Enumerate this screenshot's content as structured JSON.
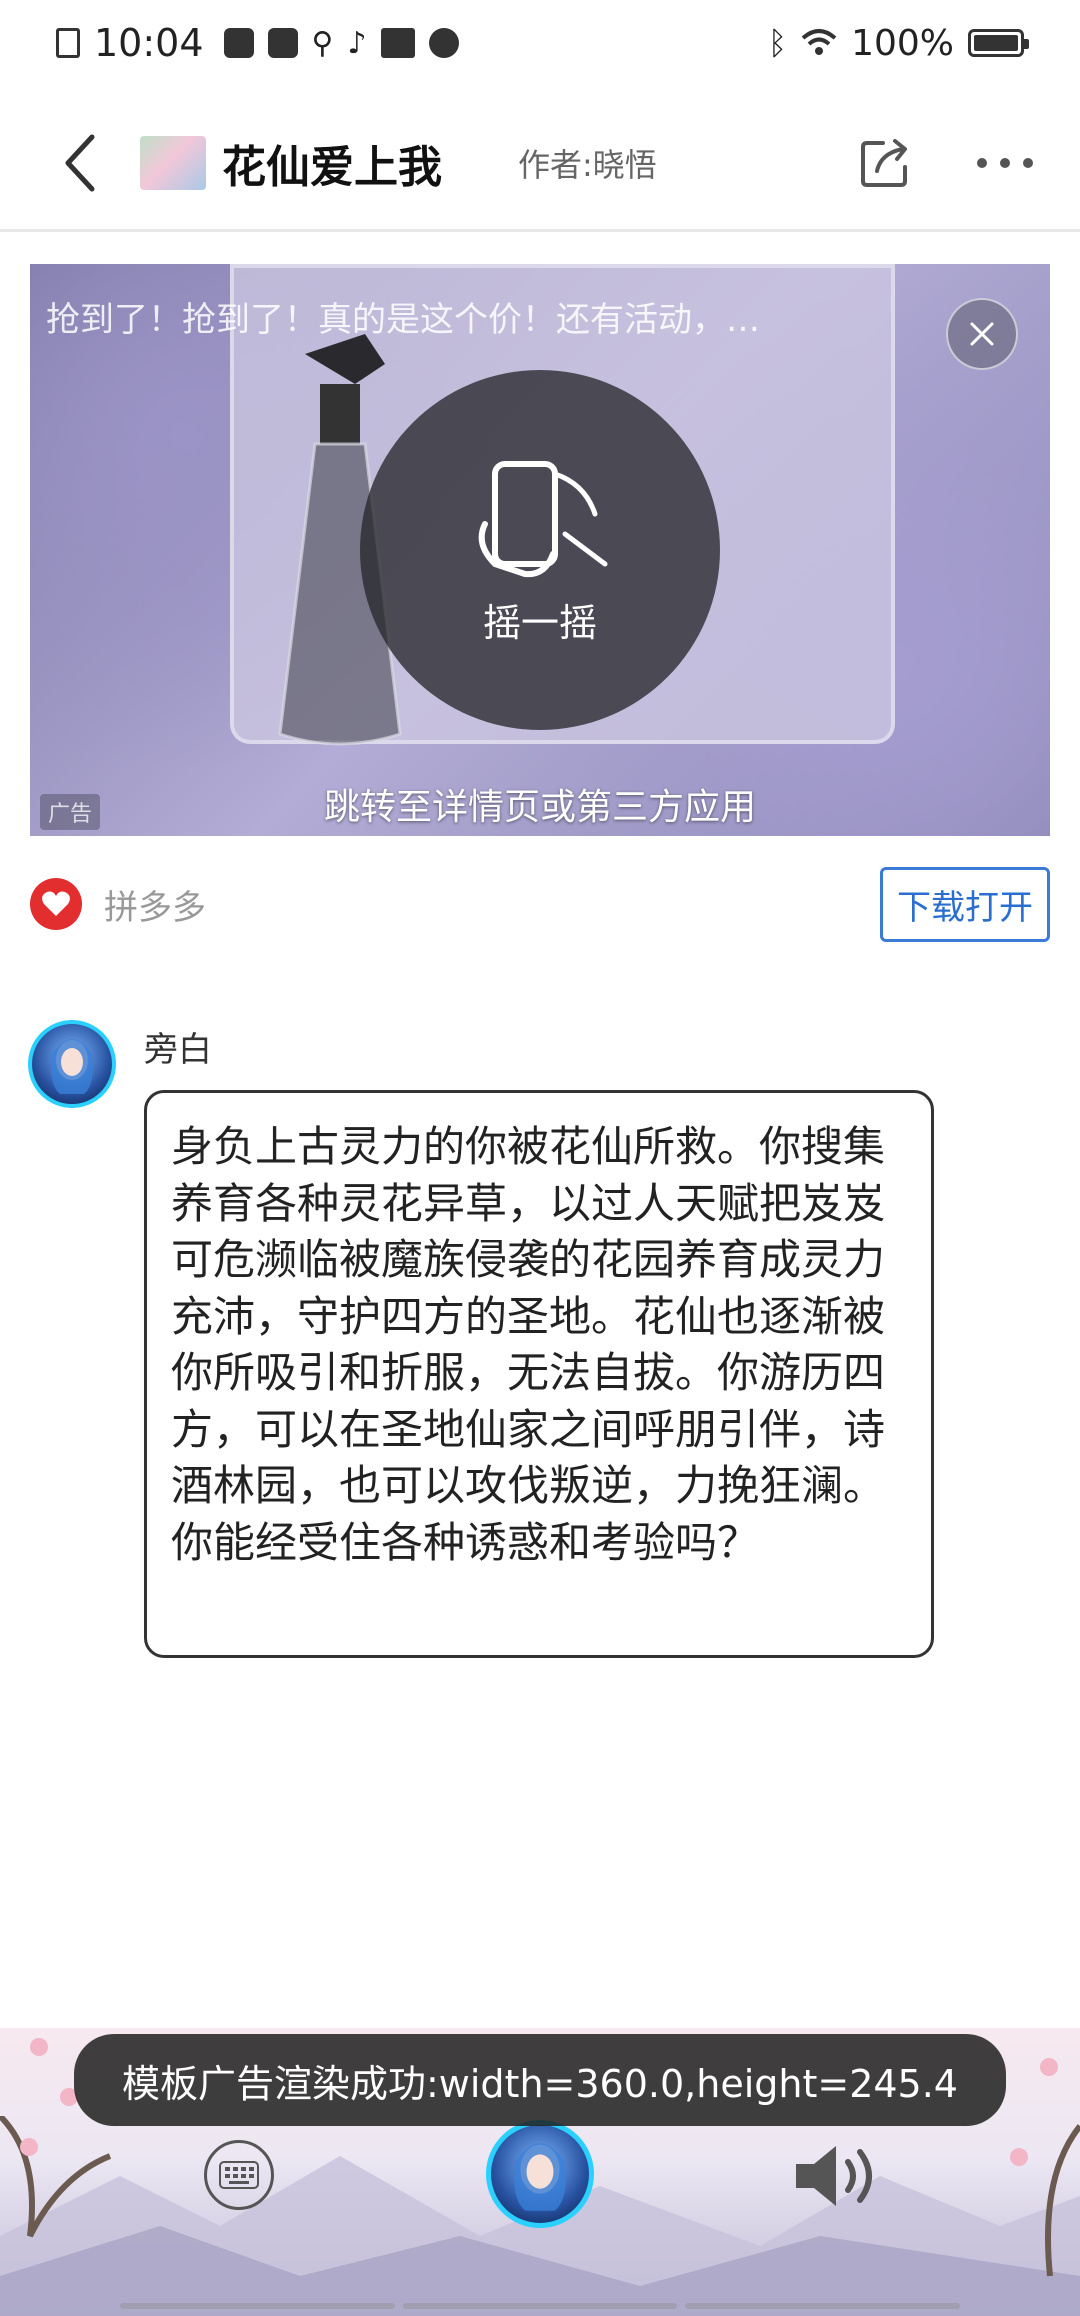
{
  "status_bar": {
    "time": "10:04",
    "battery": "100%"
  },
  "header": {
    "title": "花仙爱上我",
    "author": "作者:晓悟"
  },
  "ad": {
    "headline": "抢到了！抢到了！真的是这个价！还有活动，…",
    "shake_label": "摇一摇",
    "jump_text": "跳转至详情页或第三方应用",
    "ad_tag": "广告",
    "advertiser": "拼多多",
    "download_button": "下载打开"
  },
  "narration": {
    "speaker": "旁白",
    "text": "身负上古灵力的你被花仙所救。你搜集养育各种灵花异草，以过人天赋把岌岌可危濒临被魔族侵袭的花园养育成灵力充沛，守护四方的圣地。花仙也逐渐被你所吸引和折服，无法自拔。你游历四方，可以在圣地仙家之间呼朋引伴，诗酒林园，也可以攻伐叛逆，力挽狂澜。你能经受住各种诱惑和考验吗？"
  },
  "toast": {
    "message": "模板广告渲染成功:width=360.0,height=245.4"
  },
  "colors": {
    "accent_cyan": "#2ad0ff",
    "download_blue": "#2a6fcf",
    "pdd_red": "#e22e2e"
  }
}
